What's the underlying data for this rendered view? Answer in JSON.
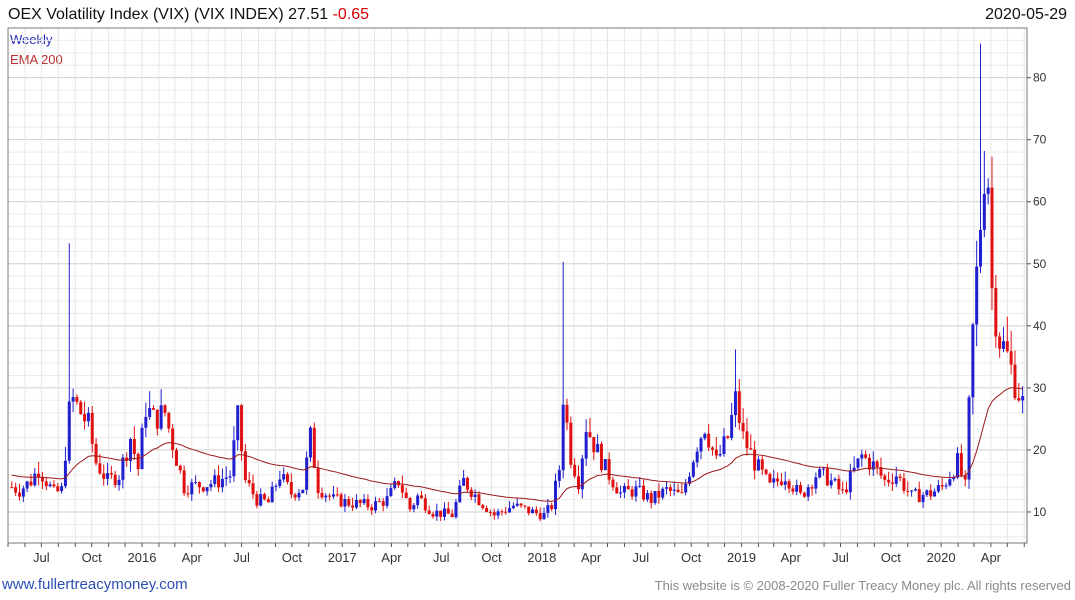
{
  "header": {
    "title": "OEX Volatility Index (VIX) (VIX INDEX)",
    "last": "27.51",
    "change": "-0.65",
    "date": "2020-05-29"
  },
  "footer": {
    "site": "www.fullertreacymoney.com",
    "copyright": "This website is © 2008-2020 Fuller Treacy Money plc. All rights reserved"
  },
  "colors": {
    "up": "#1f1fd0",
    "down": "#e01010",
    "ema": "#9e1a1a",
    "grid": "#dcdcdc"
  },
  "chart_data": {
    "type": "candlestick",
    "series": [
      {
        "name": "Weekly",
        "style": "ohlc bars (blue up, red down)"
      },
      {
        "name": "EMA 200",
        "style": "line"
      }
    ],
    "ylim": [
      5,
      88
    ],
    "y_ticks": [
      10,
      20,
      30,
      40,
      50,
      60,
      70,
      80
    ],
    "x_ticks": [
      "Jul",
      "Oct",
      "2016",
      "Apr",
      "Jul",
      "Oct",
      "2017",
      "Apr",
      "Jul",
      "Oct",
      "2018",
      "Apr",
      "Jul",
      "Oct",
      "2019",
      "Apr",
      "Jul",
      "Oct",
      "2020",
      "Apr"
    ],
    "x_range": [
      "2015-05",
      "2020-05"
    ],
    "anchors": [
      [
        "2015-05-08",
        14
      ],
      [
        "2015-05-22",
        13.5
      ],
      [
        "2015-06-12",
        15
      ],
      [
        "2015-06-26",
        17
      ],
      [
        "2015-07-10",
        15
      ],
      [
        "2015-07-24",
        13
      ],
      [
        "2015-08-07",
        13.5
      ],
      [
        "2015-08-21",
        26
      ],
      [
        "2015-08-28",
        28
      ],
      [
        "2015-09-04",
        27
      ],
      [
        "2015-09-25",
        24
      ],
      [
        "2015-10-09",
        18
      ],
      [
        "2015-10-30",
        15
      ],
      [
        "2015-11-20",
        16
      ],
      [
        "2015-12-11",
        22
      ],
      [
        "2015-12-25",
        17
      ],
      [
        "2016-01-08",
        27
      ],
      [
        "2016-01-22",
        25
      ],
      [
        "2016-02-12",
        26
      ],
      [
        "2016-02-26",
        21
      ],
      [
        "2016-03-18",
        14
      ],
      [
        "2016-04-29",
        14.5
      ],
      [
        "2016-05-20",
        15
      ],
      [
        "2016-06-10",
        16
      ],
      [
        "2016-06-24",
        25
      ],
      [
        "2016-07-08",
        15
      ],
      [
        "2016-07-29",
        12
      ],
      [
        "2016-08-19",
        11.5
      ],
      [
        "2016-09-09",
        16
      ],
      [
        "2016-09-30",
        13
      ],
      [
        "2016-10-21",
        14
      ],
      [
        "2016-11-04",
        22
      ],
      [
        "2016-11-18",
        14
      ],
      [
        "2016-12-16",
        12
      ],
      [
        "2017-01-13",
        11.5
      ],
      [
        "2017-02-24",
        11
      ],
      [
        "2017-03-24",
        12
      ],
      [
        "2017-04-14",
        15
      ],
      [
        "2017-05-05",
        10.5
      ],
      [
        "2017-05-19",
        12.5
      ],
      [
        "2017-06-16",
        10
      ],
      [
        "2017-07-21",
        9.5
      ],
      [
        "2017-08-11",
        15
      ],
      [
        "2017-09-08",
        12
      ],
      [
        "2017-10-06",
        9.5
      ],
      [
        "2017-11-10",
        11
      ],
      [
        "2017-12-15",
        10
      ],
      [
        "2018-01-05",
        9.5
      ],
      [
        "2018-01-19",
        11
      ],
      [
        "2018-02-02",
        17
      ],
      [
        "2018-02-09",
        29
      ],
      [
        "2018-02-23",
        19
      ],
      [
        "2018-03-09",
        15
      ],
      [
        "2018-03-23",
        24
      ],
      [
        "2018-04-06",
        21
      ],
      [
        "2018-04-27",
        17
      ],
      [
        "2018-05-25",
        13
      ],
      [
        "2018-06-22",
        13.5
      ],
      [
        "2018-07-20",
        12
      ],
      [
        "2018-08-17",
        13.5
      ],
      [
        "2018-09-14",
        12.5
      ],
      [
        "2018-10-12",
        21
      ],
      [
        "2018-10-26",
        24
      ],
      [
        "2018-11-16",
        18
      ],
      [
        "2018-12-07",
        22
      ],
      [
        "2018-12-21",
        28
      ],
      [
        "2019-01-04",
        22
      ],
      [
        "2019-01-25",
        18
      ],
      [
        "2019-02-22",
        14
      ],
      [
        "2019-03-22",
        16
      ],
      [
        "2019-04-19",
        12.5
      ],
      [
        "2019-05-17",
        16
      ],
      [
        "2019-06-07",
        15.5
      ],
      [
        "2019-07-05",
        13
      ],
      [
        "2019-08-09",
        19
      ],
      [
        "2019-08-30",
        17.5
      ],
      [
        "2019-09-20",
        15
      ],
      [
        "2019-10-11",
        16
      ],
      [
        "2019-11-08",
        12.5
      ],
      [
        "2019-12-13",
        13
      ],
      [
        "2020-01-03",
        14
      ],
      [
        "2020-01-31",
        18
      ],
      [
        "2020-02-14",
        14
      ],
      [
        "2020-02-28",
        39
      ],
      [
        "2020-03-13",
        57
      ],
      [
        "2020-03-20",
        66
      ],
      [
        "2020-03-27",
        64
      ],
      [
        "2020-04-03",
        46
      ],
      [
        "2020-04-17",
        38
      ],
      [
        "2020-05-01",
        35
      ],
      [
        "2020-05-15",
        31
      ],
      [
        "2020-05-29",
        27.5
      ]
    ],
    "spikes": [
      [
        "2015-08-21",
        53.3
      ],
      [
        "2016-06-24",
        26.7
      ],
      [
        "2018-02-09",
        50.3
      ],
      [
        "2018-12-21",
        36.2
      ],
      [
        "2020-03-13",
        85.5
      ]
    ]
  }
}
